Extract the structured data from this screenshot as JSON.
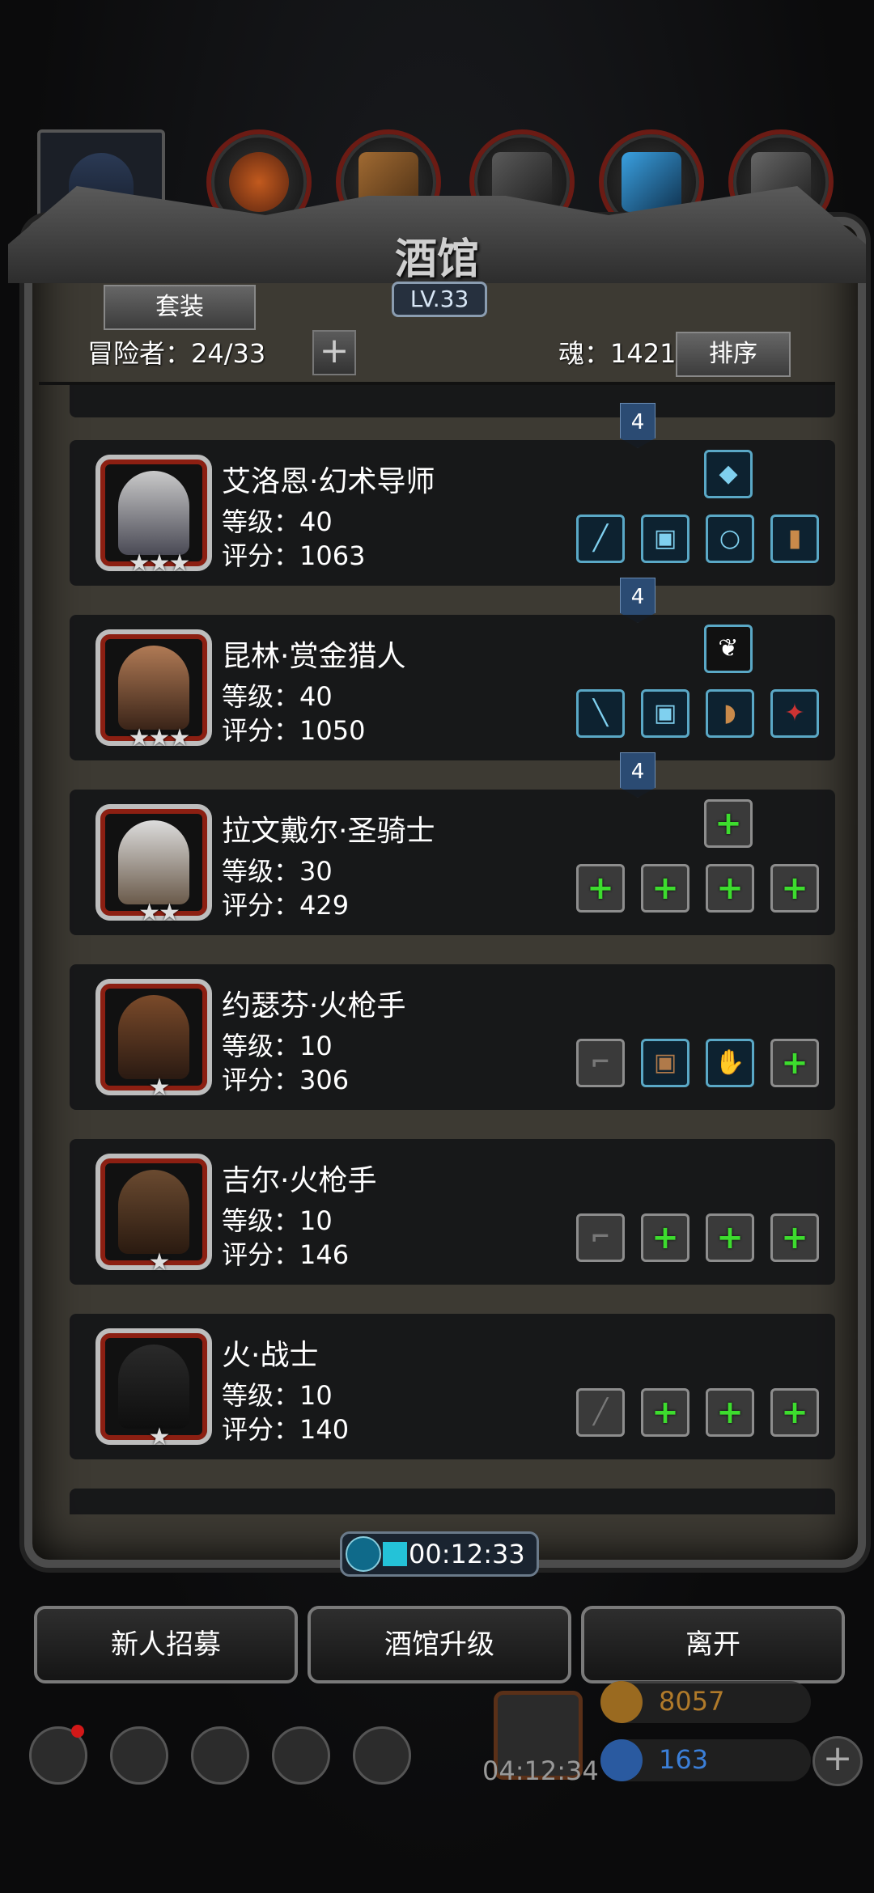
{
  "header": {
    "title": "酒馆",
    "level": "LV.33",
    "set_button": "套装",
    "adventurers_label": "冒险者：24/33",
    "add_symbol": "+",
    "soul_label": "魂：1421",
    "sort_button": "排序"
  },
  "tabs": [
    "hero-portrait",
    "potion-icon",
    "scroll-icon",
    "armor-icon",
    "crystal-icon",
    "anvil-icon"
  ],
  "heroes": [
    {
      "name": "艾洛恩·幻术导师",
      "level": "等级：40",
      "score": "评分：1063",
      "stars": "★★★",
      "tag": "4",
      "special": "crystal-icon",
      "slots": [
        "wand-icon",
        "chestplate-icon",
        "ring-icon",
        "scroll-icon"
      ]
    },
    {
      "name": "昆林·赏金猎人",
      "level": "等级：40",
      "score": "评分：1050",
      "stars": "★★★",
      "tag": "4",
      "special": "feather-icon",
      "slots": [
        "dagger-icon",
        "armor-icon",
        "horn-icon",
        "amulet-icon"
      ]
    },
    {
      "name": "拉文戴尔·圣骑士",
      "level": "等级：30",
      "score": "评分：429",
      "stars": "★★",
      "tag": "4",
      "special": "plus",
      "slots": [
        "plus",
        "plus",
        "plus",
        "plus"
      ]
    },
    {
      "name": "约瑟芬·火枪手",
      "level": "等级：10",
      "score": "评分：306",
      "stars": "★",
      "special": "",
      "slots": [
        "pistol-silhouette",
        "leather-armor-icon",
        "gauntlet-icon",
        "plus"
      ]
    },
    {
      "name": "吉尔·火枪手",
      "level": "等级：10",
      "score": "评分：146",
      "stars": "★",
      "special": "",
      "slots": [
        "pistol-silhouette",
        "plus",
        "plus",
        "plus"
      ]
    },
    {
      "name": "火·战士",
      "level": "等级：10",
      "score": "评分：140",
      "stars": "★",
      "special": "",
      "slots": [
        "sword-silhouette",
        "plus",
        "plus",
        "plus"
      ]
    }
  ],
  "timer": "00:12:33",
  "buttons": {
    "recruit": "新人招募",
    "upgrade": "酒馆升级",
    "leave": "离开"
  },
  "hud": {
    "gift_timer": "04:12:34",
    "gold": "8057",
    "gems": "163",
    "add_symbol": "+"
  },
  "colors": {
    "accent_green": "#3ddc2e",
    "gold_text": "#b07a2a",
    "gem_text": "#3b7fd8",
    "frame_red": "#8c1f12"
  }
}
